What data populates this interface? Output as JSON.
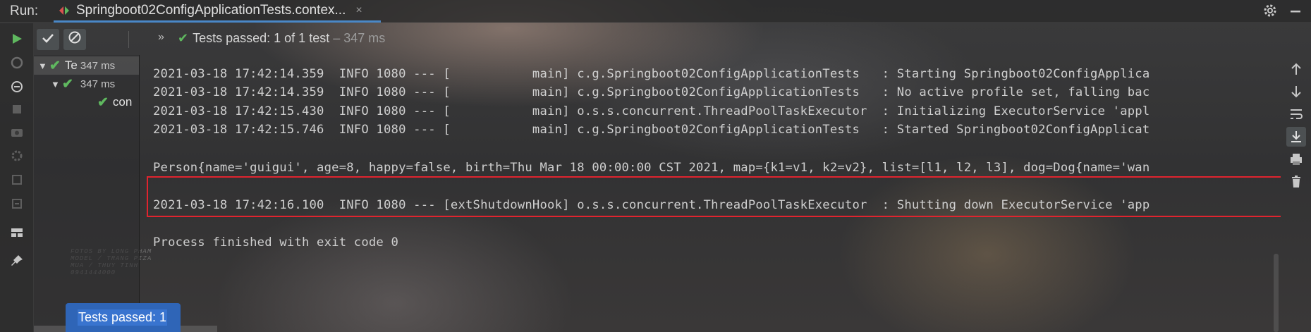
{
  "header": {
    "run_label": "Run:",
    "tab_title": "Springboot02ConfigApplicationTests.contex...",
    "tab_close": "×",
    "settings_icon": "gear-icon",
    "minimize_icon": "minimize-icon"
  },
  "toolbar": {
    "rerun_icon": "play-icon",
    "show_passed_icon": "check-icon",
    "show_ignored_icon": "ignored-icon",
    "more_icon": "chevron-right-icon",
    "more_label": "»",
    "status_check": "✔",
    "status_prefix": "Tests passed: ",
    "status_count": "1",
    "status_suffix": " of 1 test",
    "status_time": " – 347 ms"
  },
  "tree": {
    "root_label": "Te",
    "root_time": "347 ms",
    "class_time": "347 ms",
    "method_label": "con"
  },
  "console": {
    "lines": [
      "2021-03-18 17:42:14.359  INFO 1080 --- [           main] c.g.Springboot02ConfigApplicationTests   : Starting Springboot02ConfigApplica",
      "2021-03-18 17:42:14.359  INFO 1080 --- [           main] c.g.Springboot02ConfigApplicationTests   : No active profile set, falling bac",
      "2021-03-18 17:42:15.430  INFO 1080 --- [           main] o.s.s.concurrent.ThreadPoolTaskExecutor  : Initializing ExecutorService 'appl",
      "2021-03-18 17:42:15.746  INFO 1080 --- [           main] c.g.Springboot02ConfigApplicationTests   : Started Springboot02ConfigApplicat"
    ],
    "person_line": "Person{name='guigui', age=8, happy=false, birth=Thu Mar 18 00:00:00 CST 2021, map={k1=v1, k2=v2}, list=[l1, l2, l3], dog=Dog{name='wan",
    "shutdown_line": "2021-03-18 17:42:16.100  INFO 1080 --- [extShutdownHook] o.s.s.concurrent.ThreadPoolTaskExecutor  : Shutting down ExecutorService 'app",
    "exit_line": "Process finished with exit code 0"
  },
  "popup": {
    "text": "Tests passed: 1"
  },
  "watermark": {
    "lines": [
      "FOTOS BY LONG PHAM",
      "MODEL / TRANG PIZA",
      "MUA / THUY TINH",
      "0941444000"
    ]
  },
  "colors": {
    "accent": "#4a88c7",
    "pass_green": "#5fb85f",
    "highlight_red": "#e0242e",
    "popup_blue": "#2f65b7"
  }
}
